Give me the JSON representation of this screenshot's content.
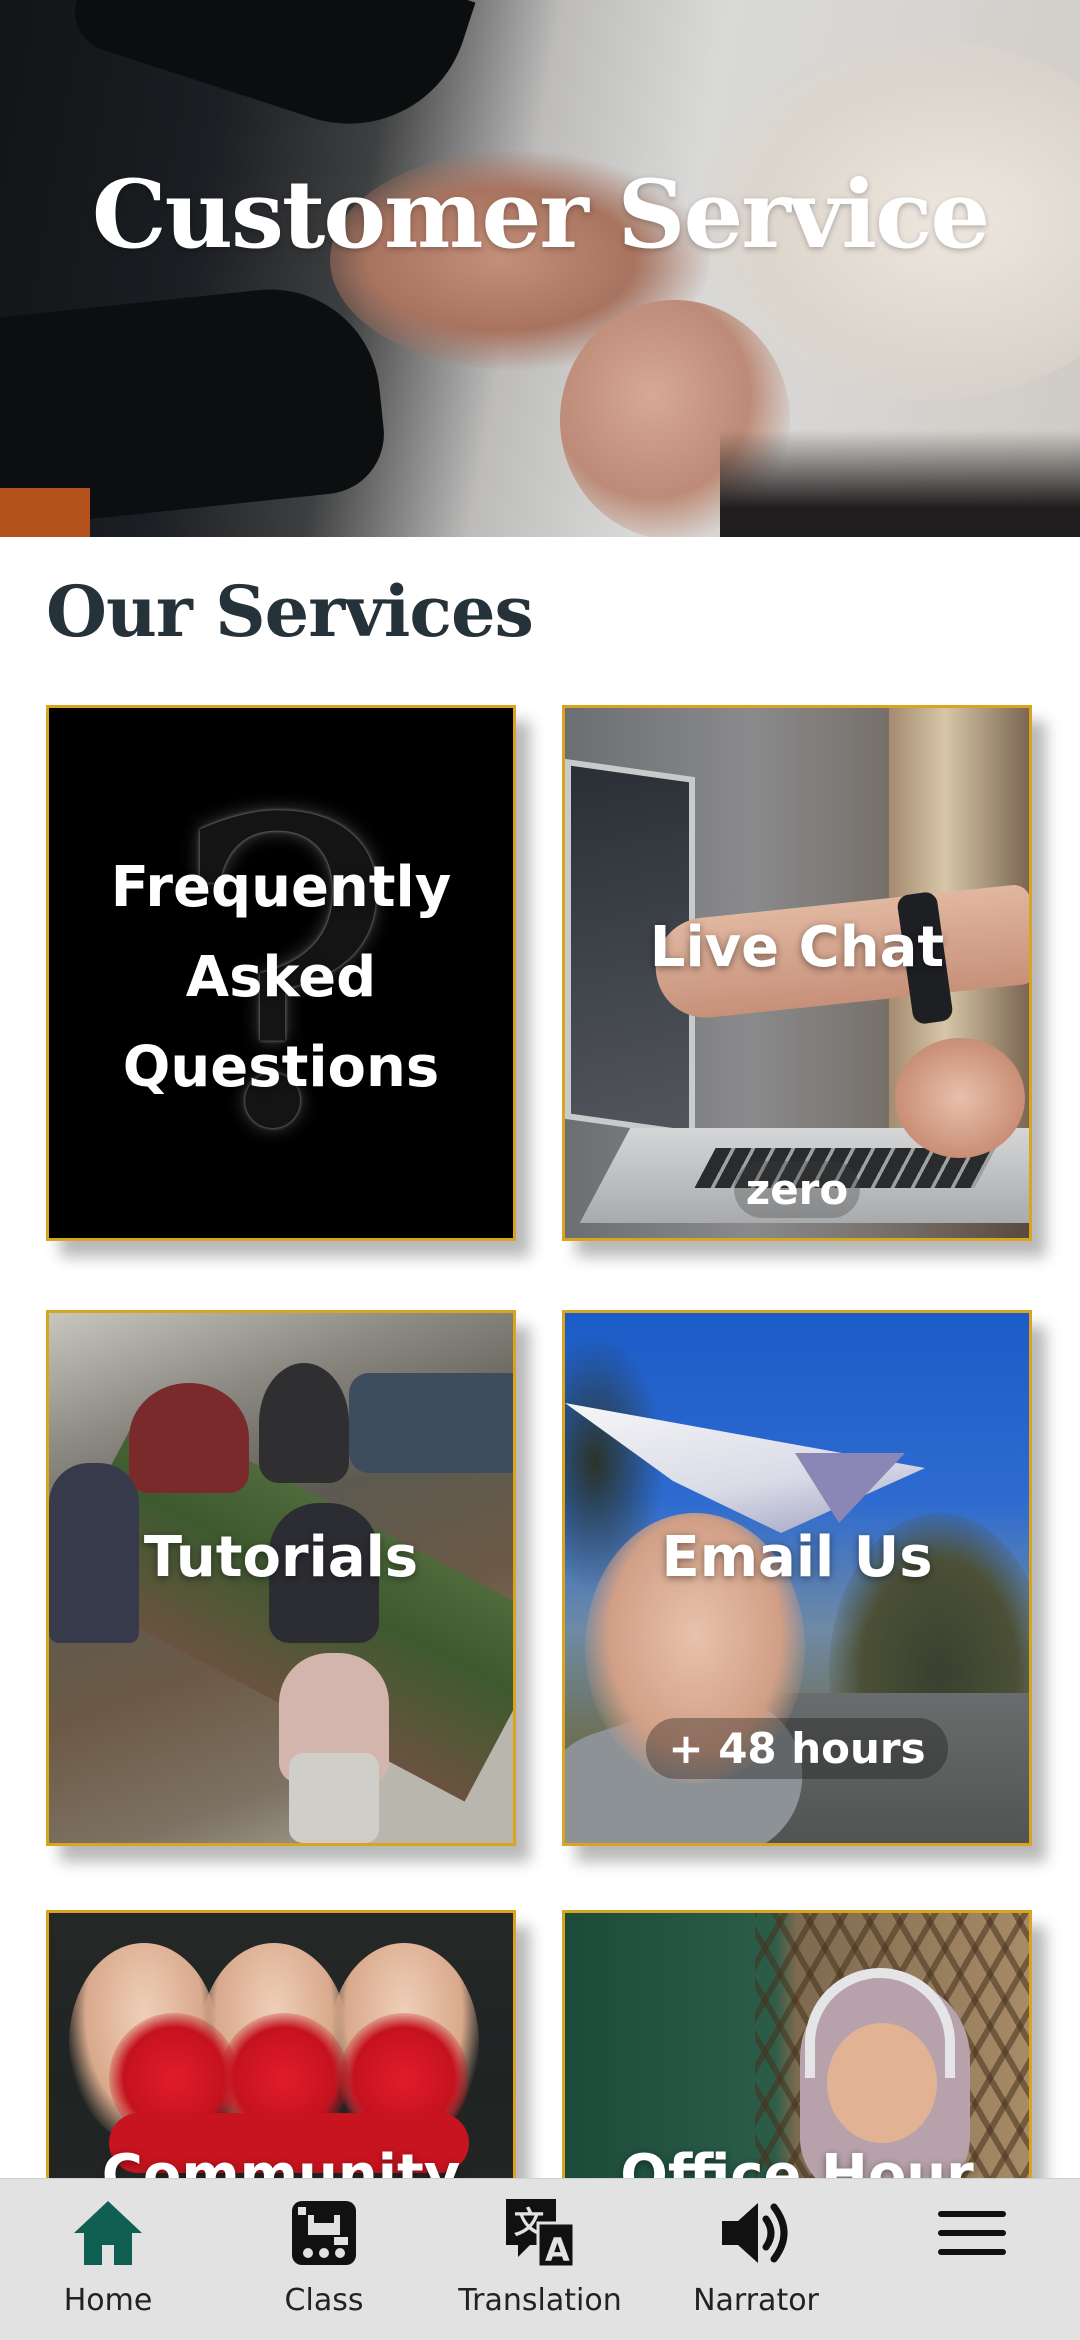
{
  "hero": {
    "title": "Customer Service"
  },
  "section": {
    "title": "Our Services"
  },
  "cards": [
    {
      "id": "faq",
      "label": "Frequently Asked Questions",
      "sub": ""
    },
    {
      "id": "live-chat",
      "label": "Live Chat",
      "sub": "zero"
    },
    {
      "id": "tutorials",
      "label": "Tutorials",
      "sub": ""
    },
    {
      "id": "email",
      "label": "Email Us",
      "sub": "+ 48 hours"
    },
    {
      "id": "community",
      "label": "Community",
      "sub": ""
    },
    {
      "id": "office-hour",
      "label": "Office Hour",
      "sub": ""
    }
  ],
  "nav": {
    "items": [
      {
        "label": "Home",
        "icon": "home-icon",
        "active": true
      },
      {
        "label": "Class",
        "icon": "class-icon",
        "active": false
      },
      {
        "label": "Translation",
        "icon": "translation-icon",
        "active": false
      },
      {
        "label": "Narrator",
        "icon": "speaker-icon",
        "active": false
      },
      {
        "label": "",
        "icon": "menu-icon",
        "active": false
      }
    ]
  },
  "colors": {
    "accent": "#0f5f52",
    "card_border": "#d9a521",
    "heading": "#26323a",
    "nav_background": "#e2e2e2"
  }
}
